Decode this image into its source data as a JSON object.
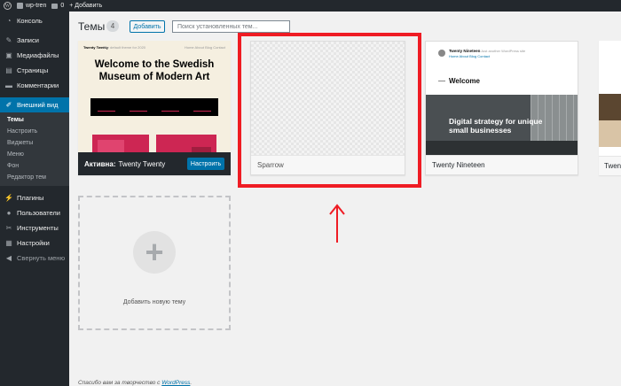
{
  "admin_bar": {
    "site_name": "wp-tren",
    "comments_count": "0",
    "new_label": "+ Добавить"
  },
  "sidebar": {
    "items_top": [
      {
        "label": "Консоль",
        "icon": "dashboard-icon"
      }
    ],
    "items_mid": [
      {
        "label": "Записи",
        "icon": "pin-icon"
      },
      {
        "label": "Медиафайлы",
        "icon": "media-icon"
      },
      {
        "label": "Страницы",
        "icon": "page-icon"
      },
      {
        "label": "Комментарии",
        "icon": "comment-icon"
      }
    ],
    "appearance": {
      "label": "Внешний вид",
      "icon": "brush-icon"
    },
    "submenu": [
      {
        "label": "Темы",
        "current": true
      },
      {
        "label": "Настроить"
      },
      {
        "label": "Виджеты"
      },
      {
        "label": "Меню"
      },
      {
        "label": "Фон"
      },
      {
        "label": "Редактор тем"
      }
    ],
    "items_bottom": [
      {
        "label": "Плагины",
        "icon": "plugin-icon"
      },
      {
        "label": "Пользователи",
        "icon": "users-icon"
      },
      {
        "label": "Инструменты",
        "icon": "tools-icon"
      },
      {
        "label": "Настройки",
        "icon": "settings-icon"
      },
      {
        "label": "Свернуть меню",
        "icon": "collapse-icon"
      }
    ],
    "accent_color": "#0073aa",
    "background_color": "#23282d"
  },
  "header": {
    "title": "Темы",
    "count": "4",
    "add_button": "Добавить",
    "search_placeholder": "Поиск установленных тем..."
  },
  "themes": {
    "active": {
      "active_prefix": "Активна:",
      "name": "Twenty Twenty",
      "customize_button": "Настроить",
      "preview": {
        "brand": "Twenty Twenty",
        "tagline": "The default theme for 2020",
        "nav": "Home  About  Blog  Contact",
        "headline": "Welcome to the Swedish Museum of Modern Art"
      }
    },
    "second": {
      "name": "Sparrow"
    },
    "third": {
      "name": "Twenty Nineteen",
      "preview": {
        "site": "Twenty Nineteen",
        "desc": "Just another WordPress site",
        "nav": "Home  About  Blog  Contact",
        "welcome": "Welcome",
        "strategy": "Digital strategy for unique small businesses"
      }
    },
    "fourth": {
      "name": "Twen"
    }
  },
  "add_new_theme": {
    "label": "Добавить новую тему"
  },
  "footer": {
    "text": "Спасибо вам за творчество с",
    "link": "WordPress"
  },
  "annotation": {
    "highlight_color": "#ef1c24"
  }
}
